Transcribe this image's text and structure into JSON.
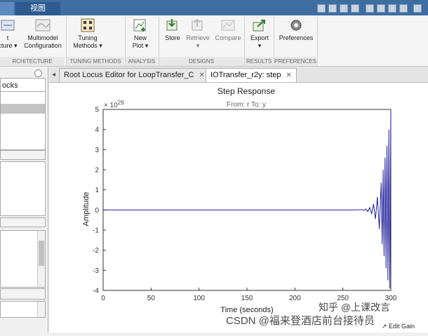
{
  "window": {
    "tabs": [
      {
        "label": "视图"
      }
    ]
  },
  "toolstrip": {
    "items": [
      {
        "label1": "t",
        "label2": "cture ▾",
        "icon": "architecture-icon"
      },
      {
        "label1": "Multimodel",
        "label2": "Configuration",
        "icon": "multimodel-icon"
      },
      {
        "label1": "Tuning",
        "label2": "Methods ▾",
        "icon": "tuning-methods-icon"
      },
      {
        "label1": "New",
        "label2": "Plot ▾",
        "icon": "new-plot-icon"
      },
      {
        "label1": "Store",
        "label2": "",
        "icon": "store-icon"
      },
      {
        "label1": "Retrieve",
        "label2": "▾",
        "icon": "retrieve-icon"
      },
      {
        "label1": "Compare",
        "label2": "",
        "icon": "compare-icon"
      },
      {
        "label1": "Export",
        "label2": "▾",
        "icon": "export-icon"
      },
      {
        "label1": "Preferences",
        "label2": "",
        "icon": "gear-icon"
      }
    ],
    "sections": [
      "RCHITECTURE",
      "TUNING METHODS",
      "ANALYSIS",
      "DESIGNS",
      "RESULTS",
      "PREFERENCES"
    ]
  },
  "left_panel": {
    "header_label": "ocks"
  },
  "doc_tabs": [
    {
      "label": "Root Locus Editor for LoopTransfer_C"
    },
    {
      "label": "IOTransfer_r2y: step"
    }
  ],
  "chart_data": {
    "type": "line",
    "title": "Step Response",
    "subtitle": "From: r  To: y",
    "xlabel": "Time (seconds)",
    "ylabel": "Amplitude",
    "exponent_label": "× 10",
    "exponent_power": "29",
    "xlim": [
      0,
      300
    ],
    "ylim": [
      -4,
      5
    ],
    "xticks": [
      "0",
      "50",
      "100",
      "150",
      "200",
      "250",
      "300"
    ],
    "yticks": [
      "-4",
      "-3",
      "-2",
      "-1",
      "0",
      "1",
      "2",
      "3",
      "4",
      "5"
    ],
    "series": [
      {
        "color": "#1f1f9e",
        "description_shape": "flat at zero until ~270 s then growing oscillation",
        "x": [
          0,
          265,
          270,
          272,
          274,
          276,
          278,
          280,
          282,
          284,
          286,
          288,
          290,
          291,
          292,
          293,
          294,
          295,
          296,
          297,
          298,
          299,
          300
        ],
        "y": [
          0,
          0,
          0.02,
          -0.03,
          0.05,
          -0.08,
          0.12,
          -0.2,
          0.3,
          -0.45,
          0.65,
          -0.95,
          1.35,
          -1.7,
          2.0,
          -2.3,
          2.6,
          -2.9,
          3.2,
          -3.5,
          4.0,
          -3.9,
          4.9
        ]
      }
    ]
  },
  "status": {
    "edit_gain_label": "Edit Gain"
  },
  "watermark": {
    "text1": "知乎 @上课改言",
    "text2": "CSDN @福来登酒店前台接待员"
  }
}
